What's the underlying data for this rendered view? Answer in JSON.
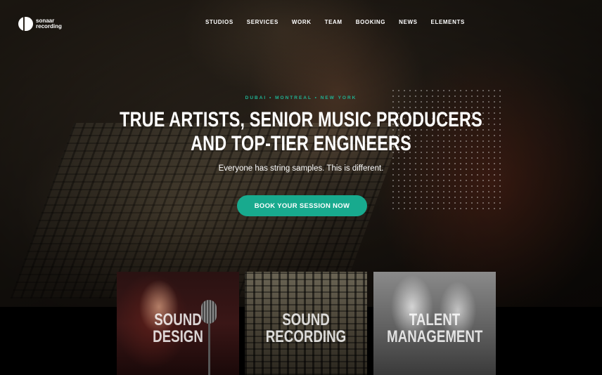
{
  "brand": {
    "name_line1": "sonaar",
    "name_line2": "recording"
  },
  "nav": {
    "items": [
      "STUDIOS",
      "SERVICES",
      "WORK",
      "TEAM",
      "BOOKING",
      "NEWS",
      "ELEMENTS"
    ]
  },
  "hero": {
    "cities": "DUBAI • MONTREAL • NEW YORK",
    "headline_line1": "TRUE ARTISTS, SENIOR MUSIC PRODUCERS",
    "headline_line2": "AND TOP-TIER ENGINEERS",
    "subline": "Everyone has string samples. This is different.",
    "cta_label": "BOOK YOUR SESSION NOW"
  },
  "services": [
    {
      "line1": "SOUND",
      "line2": "DESIGN"
    },
    {
      "line1": "SOUND",
      "line2": "RECORDING"
    },
    {
      "line1": "TALENT",
      "line2": "MANAGEMENT"
    }
  ],
  "colors": {
    "accent": "#18aa8e",
    "accent_text": "#1fb394"
  }
}
